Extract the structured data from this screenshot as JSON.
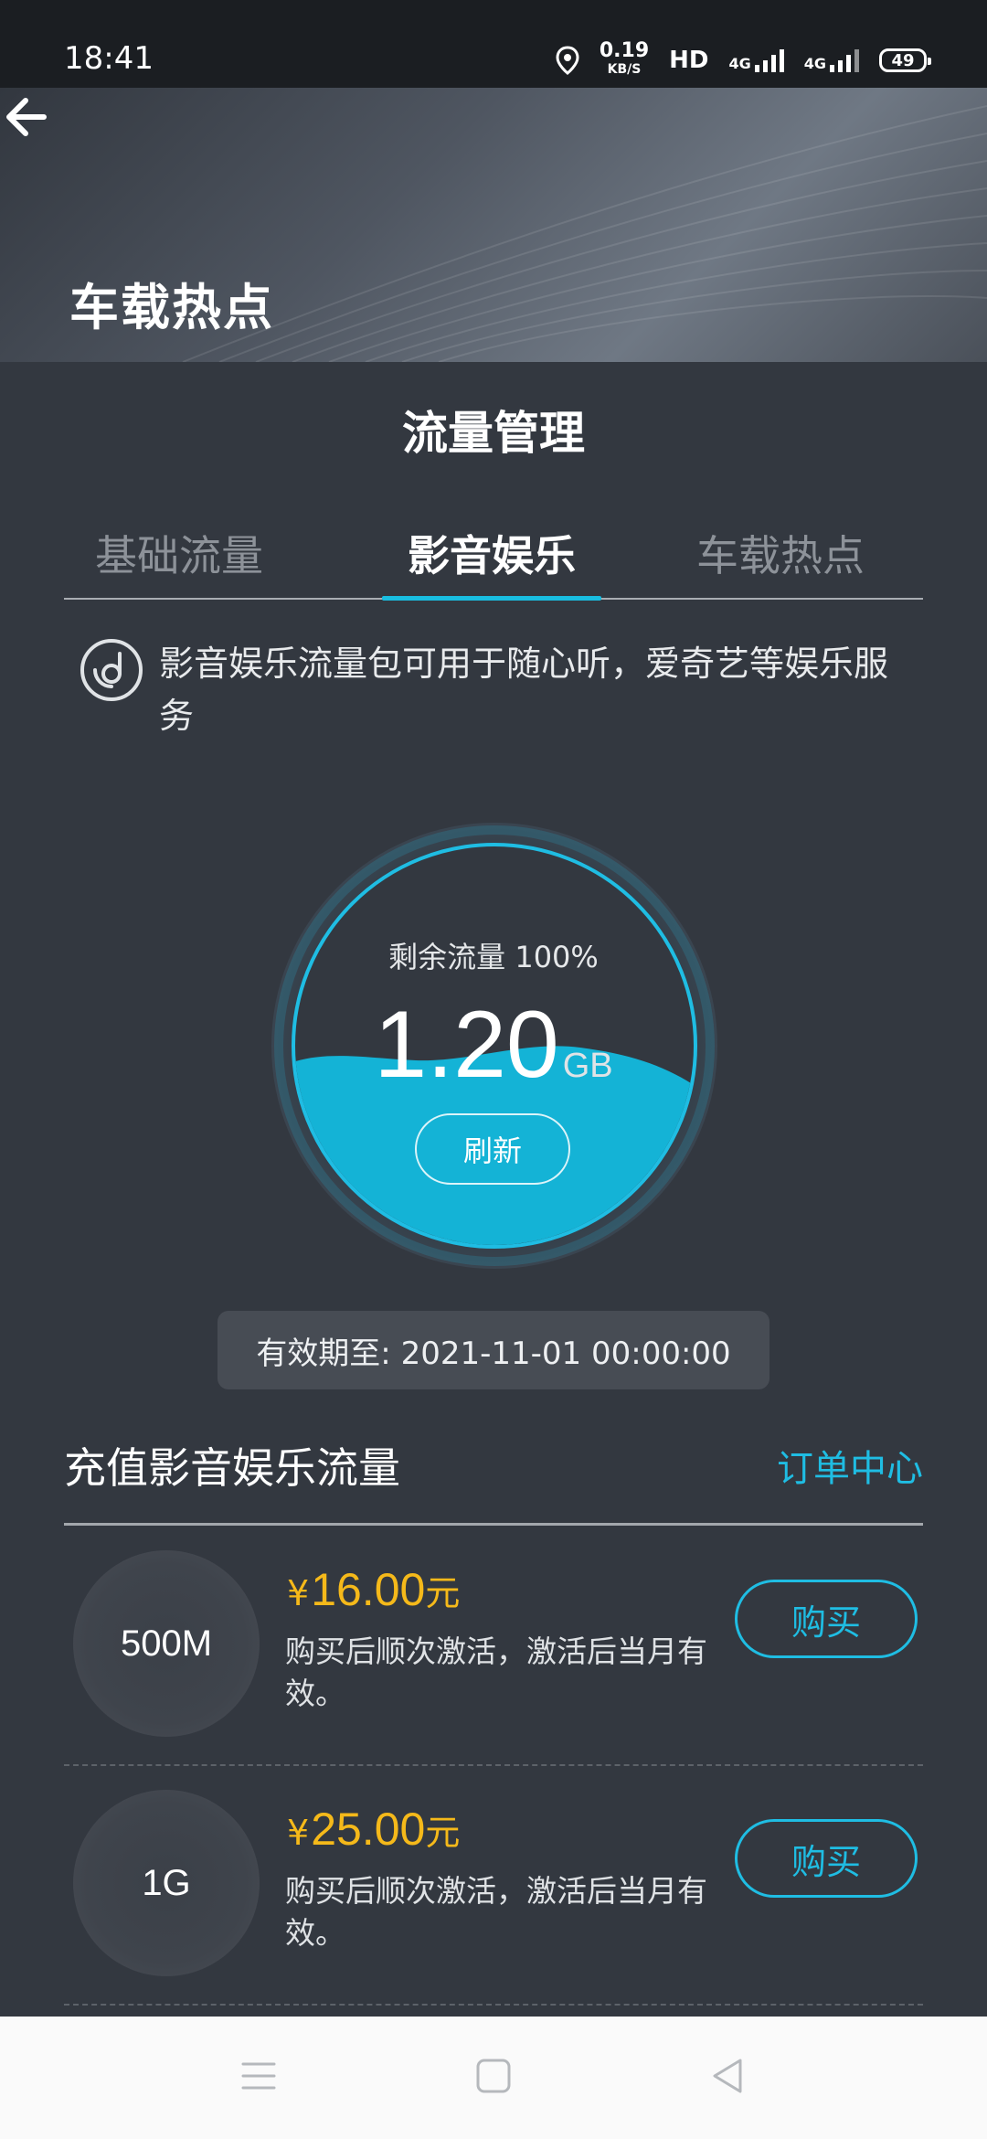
{
  "status_bar": {
    "time": "18:41",
    "speed_value": "0.19",
    "speed_unit": "KB/S",
    "hd_label": "HD",
    "sim1": "4G",
    "sim2": "4G",
    "battery": "49"
  },
  "header": {
    "title": "车载热点"
  },
  "section_title": "流量管理",
  "tabs": [
    {
      "label": "基础流量",
      "active": false
    },
    {
      "label": "影音娱乐",
      "active": true
    },
    {
      "label": "车载热点",
      "active": false
    }
  ],
  "notice": {
    "text": "影音娱乐流量包可用于随心听，爱奇艺等娱乐服务"
  },
  "gauge": {
    "label": "剩余流量 100%",
    "remaining_percent": 100,
    "value": "1.20",
    "unit": "GB",
    "refresh_label": "刷新"
  },
  "validity": {
    "text": "有效期至: 2021-11-01 00:00:00"
  },
  "recharge": {
    "title": "充值影音娱乐流量",
    "order_link": "订单中心",
    "packages": [
      {
        "size": "500M",
        "currency": "¥",
        "price": "16.00",
        "price_unit": "元",
        "desc": "购买后顺次激活，激活后当月有效。",
        "buy_label": "购买"
      },
      {
        "size": "1G",
        "currency": "¥",
        "price": "25.00",
        "price_unit": "元",
        "desc": "购买后顺次激活，激活后当月有效。",
        "buy_label": "购买"
      }
    ]
  },
  "colors": {
    "accent": "#1fbde3",
    "price": "#f5b91a",
    "background": "#333840"
  },
  "icons": {
    "back": "back-arrow-icon",
    "notice": "music-disc-icon",
    "nav_menu": "menu-icon",
    "nav_home": "home-icon",
    "nav_back": "back-triangle-icon"
  }
}
